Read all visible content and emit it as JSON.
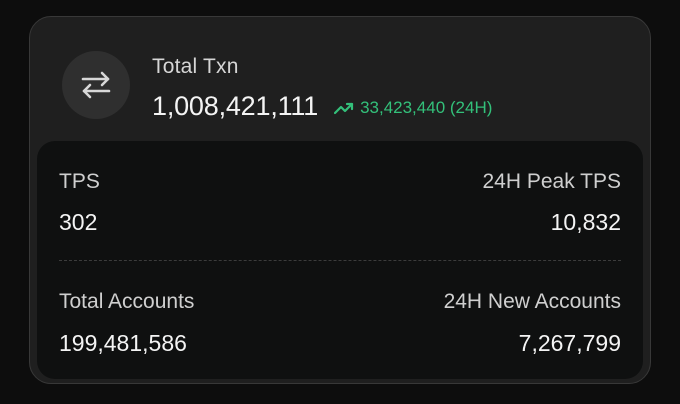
{
  "header": {
    "title": "Total Txn",
    "value": "1,008,421,111",
    "change": "33,423,440 (24H)",
    "icon": "swap-arrows-icon",
    "change_icon": "trend-up-icon",
    "change_color": "#33c07a"
  },
  "stats": {
    "tps": {
      "label": "TPS",
      "value": "302"
    },
    "peak_tps": {
      "label": "24H Peak TPS",
      "value": "10,832"
    },
    "total_accounts": {
      "label": "Total Accounts",
      "value": "199,481,586"
    },
    "new_accounts": {
      "label": "24H New Accounts",
      "value": "7,267,799"
    }
  }
}
